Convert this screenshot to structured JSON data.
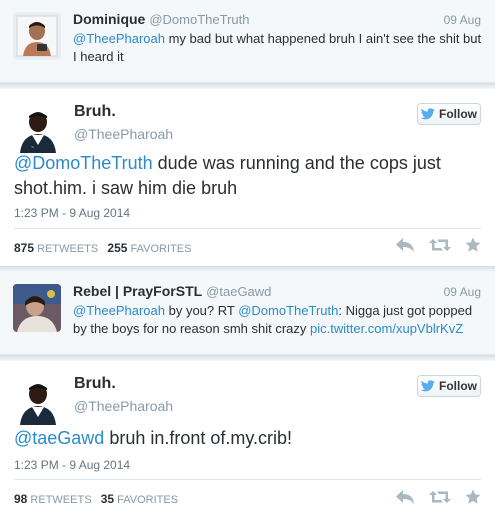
{
  "tweets": [
    {
      "kind": "compact",
      "name": "Dominique",
      "handle": "@DomoTheTruth",
      "date": "09 Aug",
      "mention": "@TheePharoah",
      "text": " my bad but what happened bruh I ain't see the shit but I heard it"
    },
    {
      "kind": "main",
      "name": "Bruh.",
      "handle": "@TheePharoah",
      "follow_label": "Follow",
      "mention": "@DomoTheTruth",
      "text": " dude was running and the cops just shot.him. i saw him die bruh",
      "time": "1:23 PM - 9 Aug 2014",
      "retweets": "875",
      "retweets_label": "RETWEETS",
      "favorites": "255",
      "favorites_label": "FAVORITES"
    },
    {
      "kind": "compact",
      "name": "Rebel | PrayForSTL",
      "handle": "@taeGawd",
      "date": "09 Aug",
      "mention": "@TheePharoah",
      "text_a": " by you? RT ",
      "mention2": "@DomoTheTruth",
      "text_b": ": Nigga just got popped by the boys for no reason smh shit crazy ",
      "link": "pic.twitter.com/xupVblrKvZ"
    },
    {
      "kind": "main",
      "name": "Bruh.",
      "handle": "@TheePharoah",
      "follow_label": "Follow",
      "mention": "@taeGawd",
      "text": " bruh in.front of.my.crib!",
      "time": "1:23 PM - 9 Aug 2014",
      "retweets": "98",
      "retweets_label": "RETWEETS",
      "favorites": "35",
      "favorites_label": "FAVORITES"
    }
  ],
  "colors": {
    "link": "#2a8bc9",
    "muted": "#8899a6",
    "icon": "#aab8c2"
  }
}
